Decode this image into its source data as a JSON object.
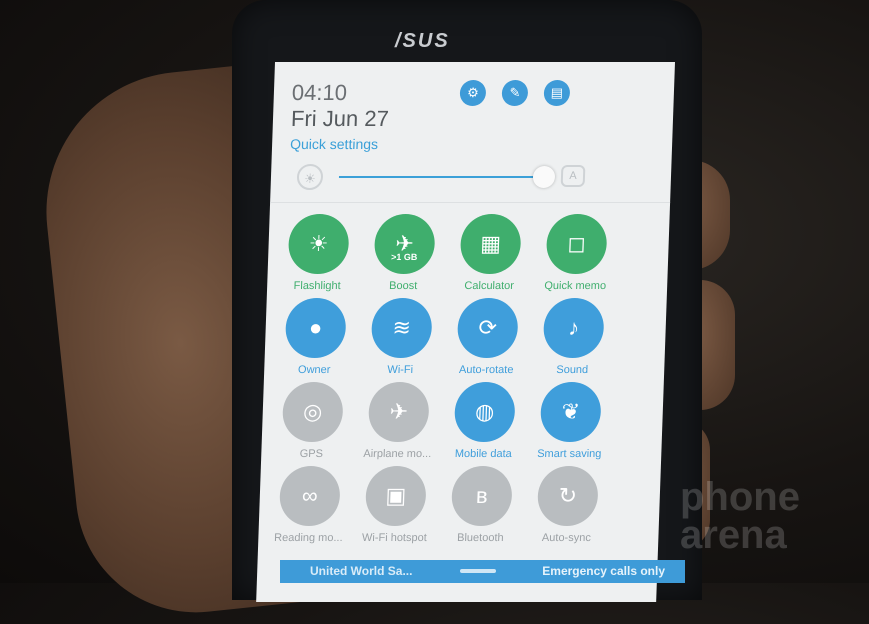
{
  "brand": "/SUS",
  "status": {
    "time": "04:10",
    "date": "Fri Jun 27",
    "quick_settings_label": "Quick settings"
  },
  "header_icons": [
    "settings-icon",
    "edit-icon",
    "notes-icon"
  ],
  "brightness": {
    "level": 0.95,
    "auto_label": "A"
  },
  "tiles": [
    {
      "id": "flashlight",
      "label": "Flashlight",
      "state": "on",
      "icon": "flashlight-icon",
      "glyph": "☀"
    },
    {
      "id": "boost",
      "label": "Boost",
      "state": "on",
      "icon": "rocket-icon",
      "glyph": "✈",
      "sub": ">1 GB"
    },
    {
      "id": "calculator",
      "label": "Calculator",
      "state": "on",
      "icon": "calculator-icon",
      "glyph": "▦"
    },
    {
      "id": "quick-memo",
      "label": "Quick memo",
      "state": "on",
      "icon": "memo-icon",
      "glyph": "◻"
    },
    {
      "id": "owner",
      "label": "Owner",
      "state": "on",
      "icon": "person-icon",
      "glyph": "●"
    },
    {
      "id": "wifi",
      "label": "Wi-Fi",
      "state": "on",
      "icon": "wifi-icon",
      "glyph": "≋"
    },
    {
      "id": "auto-rotate",
      "label": "Auto-rotate",
      "state": "on",
      "icon": "rotate-icon",
      "glyph": "⟳"
    },
    {
      "id": "sound",
      "label": "Sound",
      "state": "on",
      "icon": "speaker-icon",
      "glyph": "♪"
    },
    {
      "id": "gps",
      "label": "GPS",
      "state": "off",
      "icon": "gps-icon",
      "glyph": "◎"
    },
    {
      "id": "airplane",
      "label": "Airplane mo...",
      "state": "off",
      "icon": "airplane-icon",
      "glyph": "✈"
    },
    {
      "id": "mobile-data",
      "label": "Mobile data",
      "state": "on",
      "icon": "globe-icon",
      "glyph": "◍"
    },
    {
      "id": "smart-saving",
      "label": "Smart saving",
      "state": "on",
      "icon": "leaf-icon",
      "glyph": "❦"
    },
    {
      "id": "reading-mode",
      "label": "Reading mo...",
      "state": "off",
      "icon": "glasses-icon",
      "glyph": "∞"
    },
    {
      "id": "hotspot",
      "label": "Wi-Fi hotspot",
      "state": "off",
      "icon": "hotspot-icon",
      "glyph": "▣"
    },
    {
      "id": "bluetooth",
      "label": "Bluetooth",
      "state": "off",
      "icon": "bluetooth-icon",
      "glyph": "ʙ"
    },
    {
      "id": "auto-sync",
      "label": "Auto-sync",
      "state": "off",
      "icon": "sync-icon",
      "glyph": "↻"
    }
  ],
  "footer": {
    "carrier": "United World Sa...",
    "emergency": "Emergency calls only"
  },
  "watermark": "phone arena",
  "colors": {
    "accent_blue": "#3f9edb",
    "accent_green": "#3fae6d",
    "off_grey": "#b9bdc0"
  }
}
